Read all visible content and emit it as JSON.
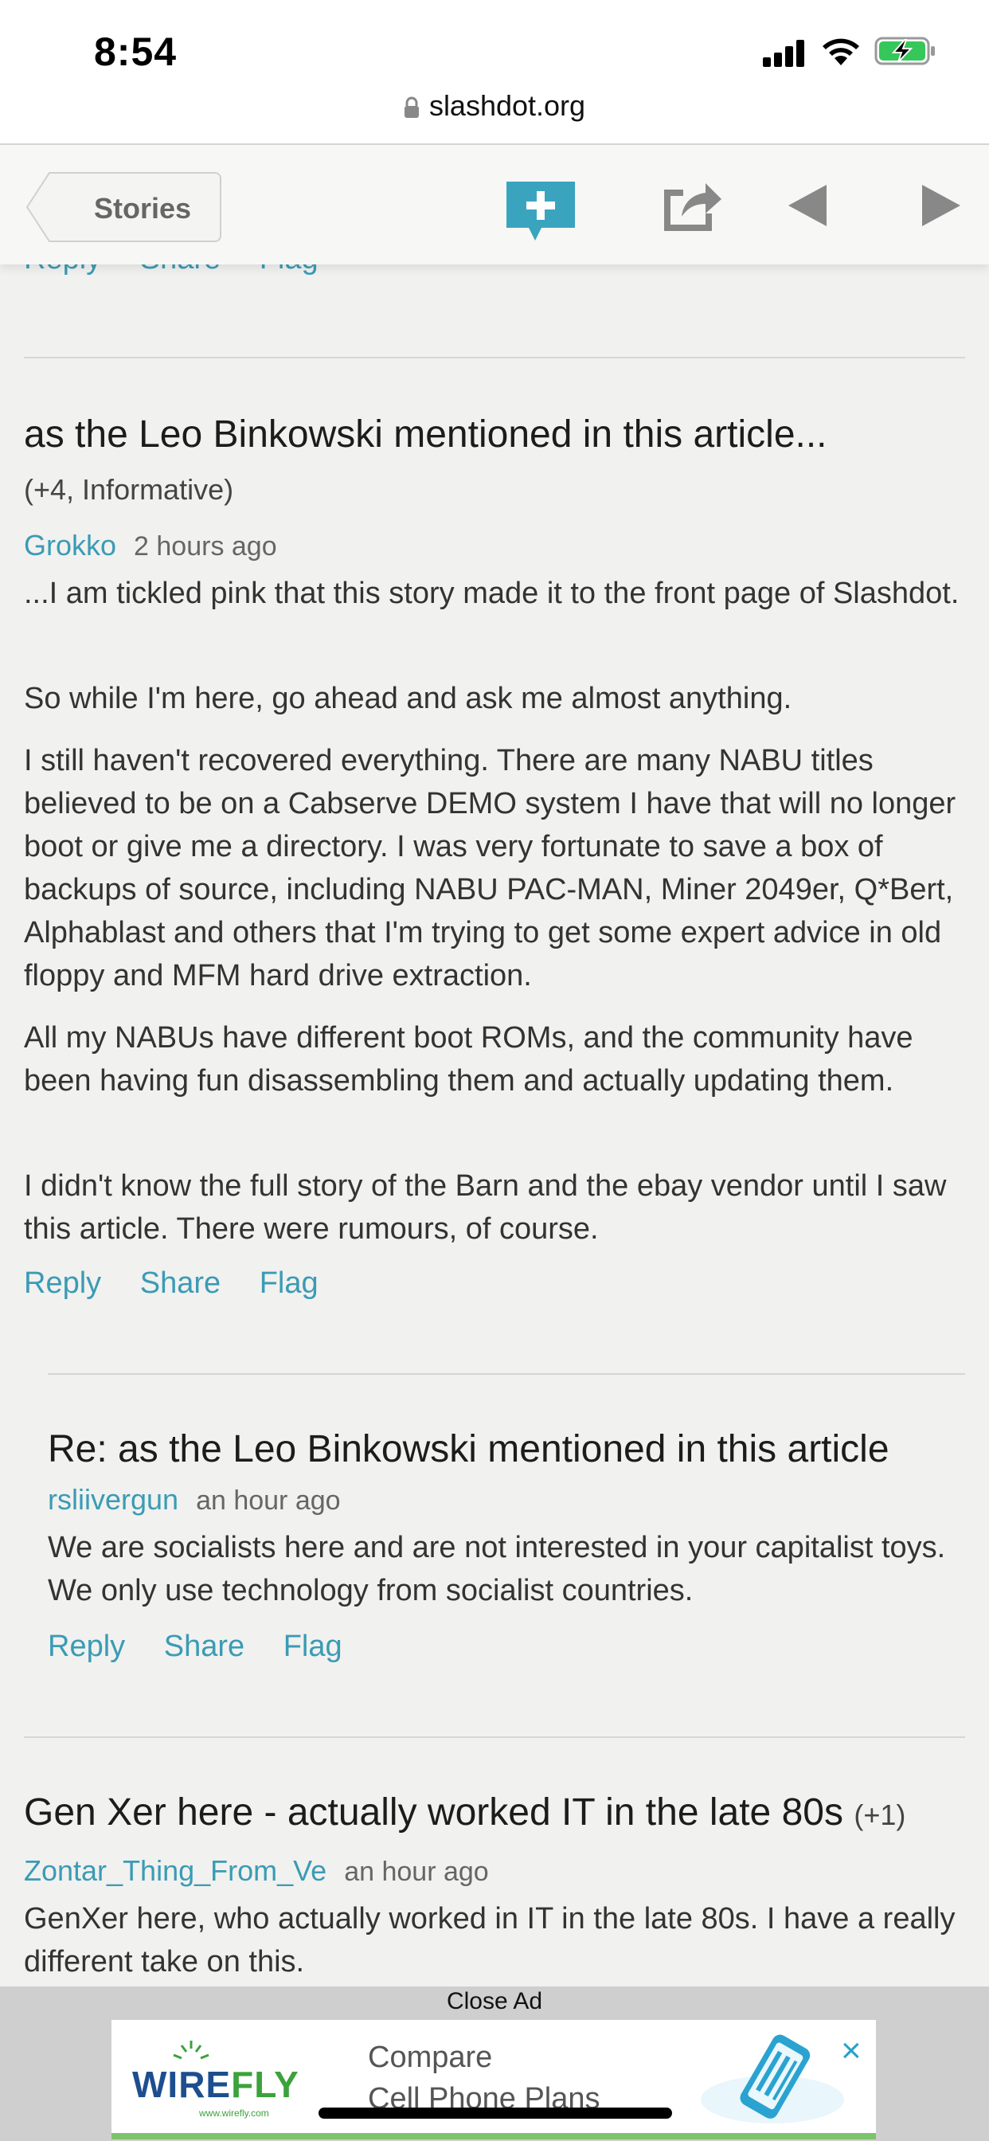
{
  "status_bar": {
    "time": "8:54",
    "url": "slashdot.org"
  },
  "toolbar": {
    "back_label": "Stories"
  },
  "previous_comment": {
    "actions": [
      "Reply",
      "Share",
      "Flag"
    ]
  },
  "comments": [
    {
      "title": "as the Leo Binkowski mentioned in this article...",
      "score": "(+4, Informative)",
      "author": "Grokko",
      "time": "2 hours ago",
      "paragraphs": [
        "...I am tickled pink that this story made it to the front page of Slashdot.",
        "So while I'm here, go ahead and ask me almost anything.",
        "I still haven't recovered everything. There are many NABU titles believed to be on a Cabserve DEMO system I have that will no longer boot or give me a directory. I was very fortunate to save a box of backups of source, including NABU PAC-MAN, Miner 2049er, Q*Bert, Alphablast and others that I'm trying to get some expert advice in old floppy and MFM hard drive extraction.",
        "All my NABUs have different boot ROMs, and the community have been having fun disassembling them and actually updating them.",
        "I didn't know the full story of the Barn and the ebay vendor until I saw this article. There were rumours, of course."
      ],
      "actions": [
        "Reply",
        "Share",
        "Flag"
      ]
    },
    {
      "title": "Re: as the Leo Binkowski mentioned in this article",
      "author": "rsliivergun",
      "time": "an hour ago",
      "paragraphs": [
        "We are socialists here and are not interested in your capitalist toys. We only use technology from socialist countries."
      ],
      "actions": [
        "Reply",
        "Share",
        "Flag"
      ]
    },
    {
      "title": "Gen Xer here - actually worked IT in the late 80s",
      "score": "(+1)",
      "author": "Zontar_Thing_From_Ve",
      "time": "an hour ago",
      "paragraphs": [
        "GenXer here, who actually worked in IT in the late 80s. I have a really different take on this."
      ]
    }
  ],
  "ad": {
    "close_label": "Close Ad",
    "brand_a": "WIRE",
    "brand_b": "FLY",
    "brand_url": "www.wirefly.com",
    "line1": "Compare",
    "line2": "Cell Phone Plans",
    "close_icon": "×"
  },
  "colors": {
    "link": "#3a9bb5",
    "accent": "#3aa4bf",
    "background": "#f1f1ef"
  }
}
